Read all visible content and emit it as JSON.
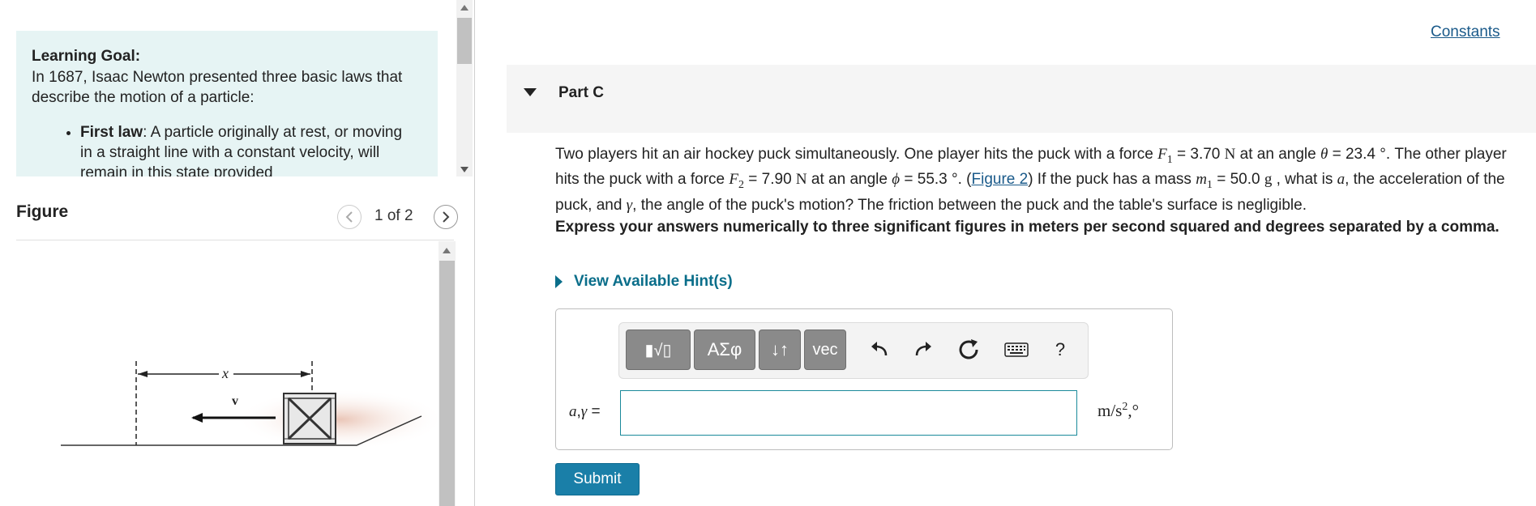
{
  "left_pane": {
    "learning_goal": {
      "title": "Learning Goal:",
      "intro": "In 1687, Isaac Newton presented three basic laws that describe the motion of a particle:",
      "laws": [
        {
          "name": "First law",
          "text": ": A particle originally at rest, or moving in a straight line with a constant velocity, will remain in this state provided"
        }
      ]
    },
    "figure": {
      "title": "Figure",
      "counter": "1 of 2",
      "prev_icon": "chevron-left-icon",
      "next_icon": "chevron-right-icon",
      "labels": {
        "distance": "x",
        "velocity": "v"
      }
    }
  },
  "right_pane": {
    "constants_link": "Constants",
    "part": {
      "title": "Part C"
    },
    "question": {
      "s1": "Two players hit an air hockey puck simultaneously.  One player hits the puck with a force ",
      "F1_sym": "F",
      "F1_sub": "1",
      "s2": " = 3.70 ",
      "unit_N": "N",
      "s3": " at an angle ",
      "theta": "θ",
      "s4": " = 23.4 °.  The other player hits the puck with a force ",
      "F2_sym": "F",
      "F2_sub": "2",
      "s5": " = 7.90 ",
      "s6": " at an angle ",
      "phi": "ϕ",
      "s7": " = 55.3 °. (",
      "figure_link": "Figure 2",
      "s8": ") If the puck has a mass ",
      "m_sym": "m",
      "m_sub": "1",
      "s9": " = 50.0 ",
      "unit_g": "g",
      "s10": " , what is ",
      "a_sym": "a",
      "s11": ", the acceleration of the puck, and ",
      "gamma": "γ",
      "s12": ", the angle of the puck's motion?  The friction between the puck and the table's surface is negligible."
    },
    "instructions": "Express your answers numerically to three significant figures in meters per second squared and degrees separated by a comma.",
    "hint_link": "View Available Hint(s)",
    "toolbar": {
      "templates_label": "▮√▯",
      "greek_label": "ΑΣφ",
      "arrows_label": "↓↑",
      "vec_label": "vec",
      "undo_icon": "undo-icon",
      "redo_icon": "redo-icon",
      "reset_icon": "reset-icon",
      "keyboard_icon": "keyboard-icon",
      "help_label": "?"
    },
    "answer": {
      "lhs_vars": "a",
      "lhs_sep": ",",
      "lhs_var2": "γ",
      "lhs_eq": " =",
      "value": "",
      "units_base": "m/s",
      "units_exp": "2",
      "units_tail": ",°"
    },
    "submit_label": "Submit"
  }
}
